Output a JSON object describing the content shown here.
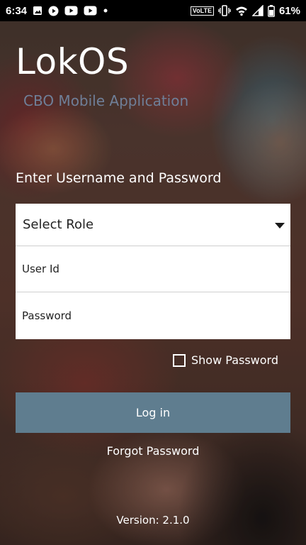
{
  "status_bar": {
    "time": "6:34",
    "network_badge": "VoLTE",
    "battery_percent": "61%",
    "left_icons": [
      "gallery-icon",
      "play-circle-icon",
      "youtube-icon",
      "youtube-icon",
      "dot-icon"
    ],
    "right_icons": [
      "vibrate-icon",
      "wifi-icon",
      "signal-icon",
      "battery-icon"
    ]
  },
  "header": {
    "title": "LokOS",
    "subtitle": "CBO Mobile Application"
  },
  "form": {
    "instruction": "Enter Username and Password",
    "role_select": {
      "value": "Select Role"
    },
    "user_id": {
      "placeholder": "User Id"
    },
    "password": {
      "placeholder": "Password"
    },
    "show_password_label": "Show Password",
    "show_password_checked": false,
    "login_label": "Log in",
    "forgot_label": "Forgot Password"
  },
  "footer": {
    "version": "Version: 2.1.0"
  },
  "colors": {
    "subtitle": "#6f7f98",
    "login_button": "#5f7d8f",
    "status_bar": "#000000"
  }
}
